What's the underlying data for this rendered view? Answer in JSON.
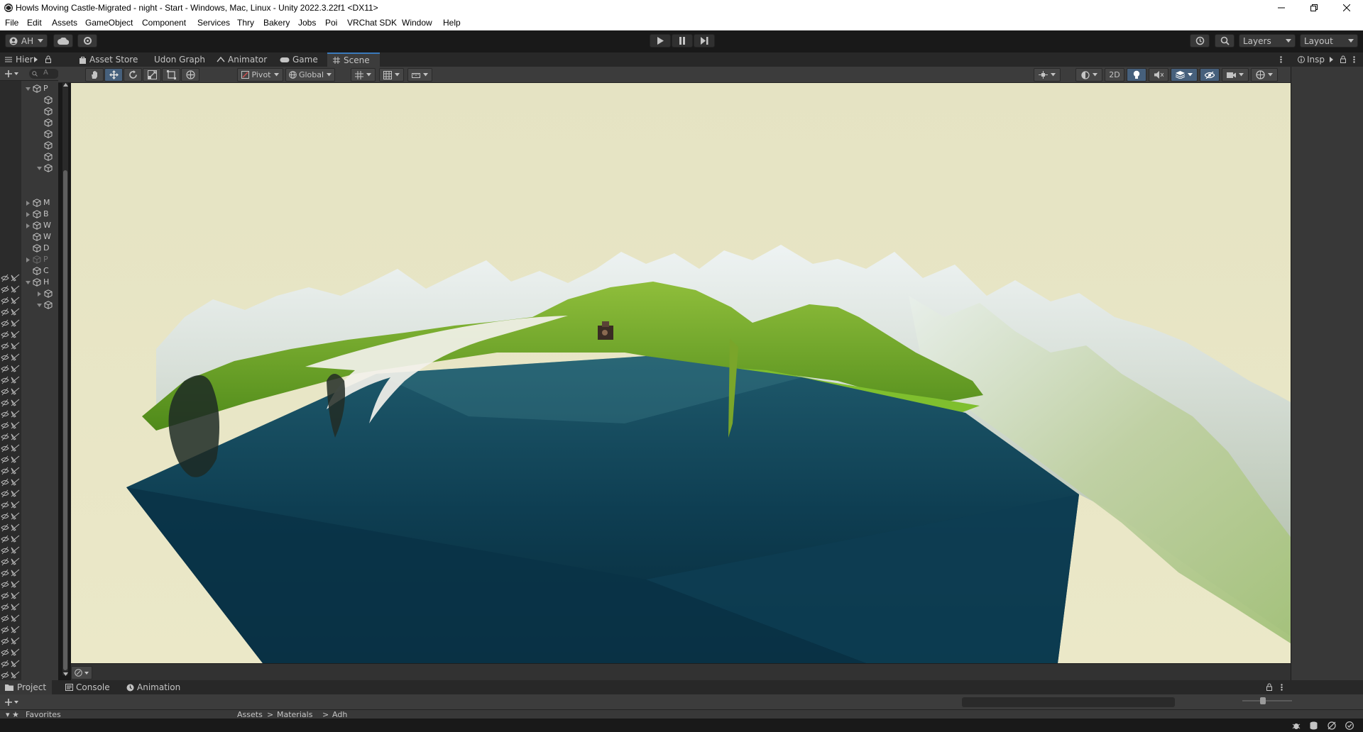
{
  "window": {
    "title": "Howls Moving Castle-Migrated - night - Start - Windows, Mac, Linux - Unity 2022.3.22f1 <DX11>"
  },
  "menu": {
    "items": [
      "File",
      "Edit",
      "Assets",
      "GameObject",
      "Component",
      "Services",
      "Thry",
      "Bakery",
      "Jobs",
      "Poi",
      "VRChat SDK",
      "Window",
      "Help"
    ]
  },
  "toolbar": {
    "account": "AH",
    "layers": "Layers",
    "layout": "Layout"
  },
  "hierarchy": {
    "tab": "Hier",
    "search_placeholder": "A",
    "rows": [
      "P",
      "",
      "",
      "",
      "",
      "",
      "",
      "",
      "M",
      "B",
      "W",
      "W",
      "D",
      "P",
      "C",
      "H",
      "",
      ""
    ]
  },
  "scene": {
    "tabs": [
      "Asset Store",
      "Udon Graph",
      "Animator",
      "Game",
      "Scene"
    ],
    "active_tab": "Scene",
    "pivot": "Pivot",
    "global": "Global",
    "two_d": "2D"
  },
  "inspector": {
    "tab": "Insp"
  },
  "bottom": {
    "tabs": [
      "Project",
      "Console",
      "Animation"
    ],
    "favorites": "Favorites",
    "breadcrumb": [
      "Assets",
      ">",
      "Materials",
      ">",
      "Adh"
    ]
  },
  "colors": {
    "accent": "#3a79bb",
    "sky": "#e8e6c4",
    "water": "#0c3a50",
    "grass": "#6aa528",
    "snow": "#e6eef2"
  }
}
